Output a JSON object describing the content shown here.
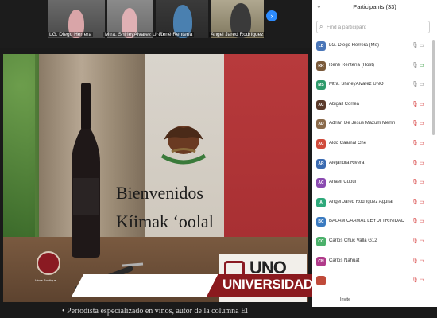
{
  "video_strip": {
    "tiles": [
      {
        "name": "LG. Diego Herrera"
      },
      {
        "name": "Mtra. ShirleyAlvarez UNO"
      },
      {
        "name": "René Rentería"
      },
      {
        "name": "Ángel Jared Rodríguez Aguilar"
      }
    ],
    "next_icon": "chevron-right-icon",
    "next_glyph": "›"
  },
  "shared_screen": {
    "line1": "Bienvenidos",
    "line2": "Kíimak ‘oolal",
    "brand_small": "Vinos Boutique",
    "uno_text": "UNO",
    "uno_sub": "Universidad de Oriente"
  },
  "banner": {
    "text": "UNIVERSIDAD DE ORIENTE"
  },
  "below_text": "• Periodista especializado en vinos, autor de la columna El",
  "participants": {
    "title": "Participants (33)",
    "collapse_glyph": "⌄",
    "search_placeholder": "Find a participant",
    "search_glyph": "⌕",
    "list": [
      {
        "name": "LG. Diego Herrera (Me)",
        "initials": "LD",
        "color": "#4a76b8",
        "mic": "on",
        "cam": "off"
      },
      {
        "name": "René Rentería (Host)",
        "initials": "RR",
        "color": "#7a5a3a",
        "mic": "on",
        "cam": "on"
      },
      {
        "name": "Mtra. ShirleyAlvarez UNO",
        "initials": "MS",
        "color": "#2e9a6a",
        "mic": "on",
        "cam": "off"
      },
      {
        "name": "Abigail Correa",
        "initials": "AC",
        "color": "#5a3a2a",
        "mic": "muted",
        "cam": "muted"
      },
      {
        "name": "Adrián De Jesus Mazum Merlin",
        "initials": "AD",
        "color": "#8a6a4a",
        "mic": "muted",
        "cam": "muted"
      },
      {
        "name": "Aldo Caamal Che",
        "initials": "AC",
        "color": "#d04a3a",
        "mic": "muted",
        "cam": "muted"
      },
      {
        "name": "Alejandra Rivera",
        "initials": "AR",
        "color": "#3a6ab0",
        "mic": "muted",
        "cam": "muted"
      },
      {
        "name": "Anaeli Cupul",
        "initials": "AC",
        "color": "#8a4ab0",
        "mic": "muted",
        "cam": "muted"
      },
      {
        "name": "Ángel Jared Rodríguez Aguilar",
        "initials": "Á",
        "color": "#2ea87a",
        "mic": "muted",
        "cam": "muted"
      },
      {
        "name": "BALAM CAAMAL LEYDI TRINIDAD",
        "initials": "BC",
        "color": "#3a7ac0",
        "mic": "muted",
        "cam": "muted"
      },
      {
        "name": "Carlos Chuc Valla G12",
        "initials": "CC",
        "color": "#4ab06a",
        "mic": "muted",
        "cam": "muted"
      },
      {
        "name": "Carlos Nahuat",
        "initials": "CN",
        "color": "#b03a8a",
        "mic": "muted",
        "cam": "muted"
      },
      {
        "name": "",
        "initials": "",
        "color": "#c04a3a",
        "mic": "muted",
        "cam": "muted"
      }
    ],
    "invite_label": "Invite",
    "mic_glyph": "🎙",
    "cam_glyph": "▭"
  },
  "colors": {
    "accent_blue": "#2d8cff",
    "brand_red": "#8b1a1e",
    "muted_red": "#d63b3b"
  }
}
